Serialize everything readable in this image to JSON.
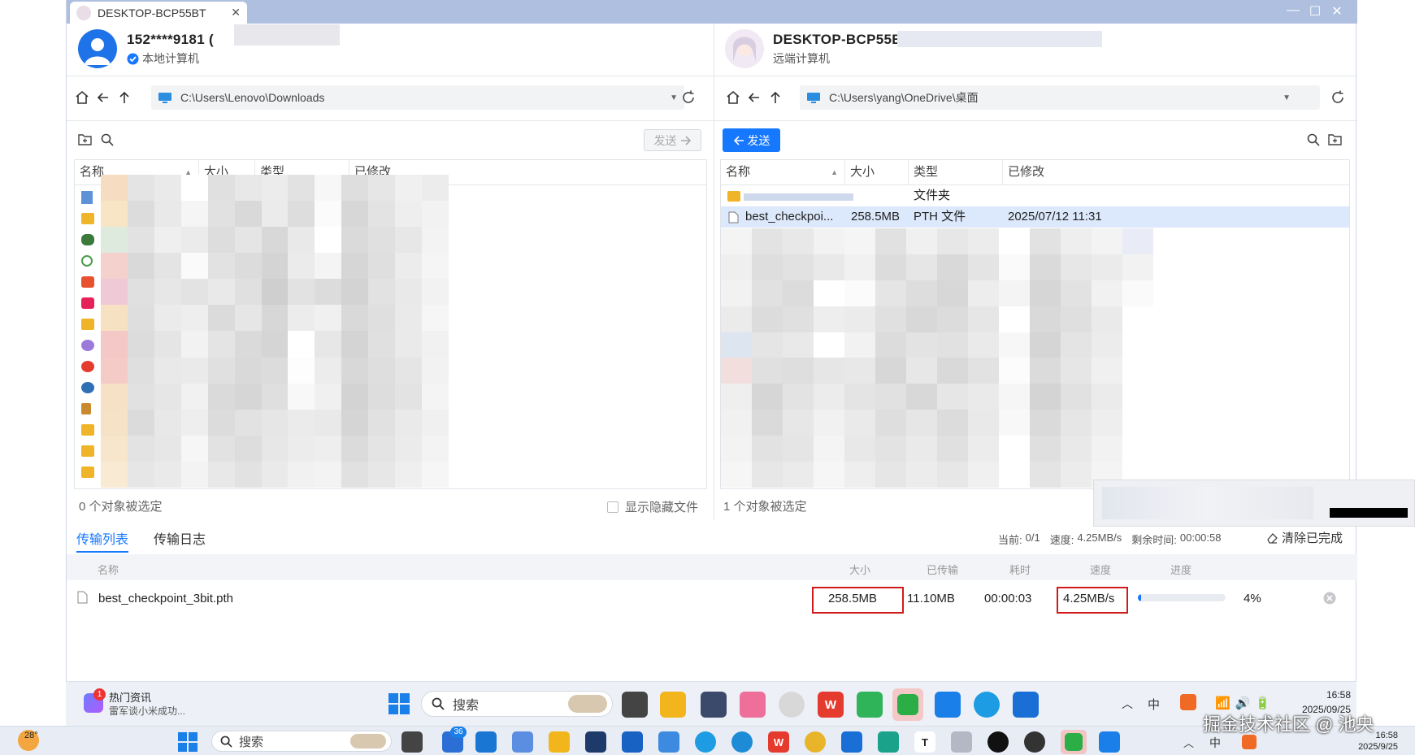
{
  "window": {
    "tab_title": "DESKTOP-BCP55BT",
    "tab_close": "✕",
    "controls": {
      "minimize": "—",
      "maximize": "☐",
      "close": "✕"
    }
  },
  "local": {
    "account": "152****9181 (",
    "role": "本地计算机",
    "path": "C:\\Users\\Lenovo\\Downloads",
    "columns": [
      "名称",
      "大小",
      "类型",
      "已修改"
    ],
    "send_label": "发送",
    "status": "0 个对象被选定",
    "show_hidden": "显示隐藏文件"
  },
  "remote": {
    "device": "DESKTOP-BCP55BT",
    "role": "远端计算机",
    "path": "C:\\Users\\yang\\OneDrive\\桌面",
    "columns": [
      "名称",
      "大小",
      "类型",
      "已修改"
    ],
    "send_label": "发送",
    "rows": [
      {
        "name": "",
        "size": "",
        "type": "文件夹",
        "modified": ""
      },
      {
        "name": "best_checkpoi...",
        "size": "258.5MB",
        "type": "PTH 文件",
        "modified": "2025/07/12 11:31"
      }
    ],
    "status": "1 个对象被选定"
  },
  "transfer": {
    "tabs": [
      "传输列表",
      "传输日志"
    ],
    "summary": {
      "current_label": "当前:",
      "current": "0/1",
      "speed_label": "速度:",
      "speed": "4.25MB/s",
      "remaining_label": "剩余时间:",
      "remaining": "00:00:58",
      "clear": "清除已完成"
    },
    "headers": {
      "name": "名称",
      "size": "大小",
      "transferred": "已传输",
      "elapsed": "耗时",
      "speed": "速度",
      "progress": "进度"
    },
    "item": {
      "name": "best_checkpoint_3bit.pth",
      "size": "258.5MB",
      "transferred": "11.10MB",
      "elapsed": "00:00:03",
      "speed": "4.25MB/s",
      "progress_text": "4%",
      "progress": 0.04
    }
  },
  "taskbar": {
    "news_badge": "1",
    "news_title": "热门资讯",
    "news_sub": "雷军谈小米成功...",
    "search": "搜索",
    "wechat_badge": "36",
    "ime": "中",
    "time1": "16:58",
    "date1": "2025/09/25",
    "time2": "16:58",
    "date2": "2025/9/25",
    "weather": "28°",
    "watermark": "掘金技术社区 @ 池央"
  },
  "icons": [
    "home-icon",
    "back-icon",
    "up-icon",
    "monitor-icon",
    "refresh-icon",
    "new-folder-icon",
    "search-icon",
    "file-icon",
    "folder-icon",
    "clear-icon",
    "cancel-icon",
    "windows-icon"
  ],
  "colors": {
    "accent": "#1677ff",
    "titlebar": "#aebfdf",
    "highlight": "#d11a1a",
    "selected_row": "#dce8fb"
  }
}
